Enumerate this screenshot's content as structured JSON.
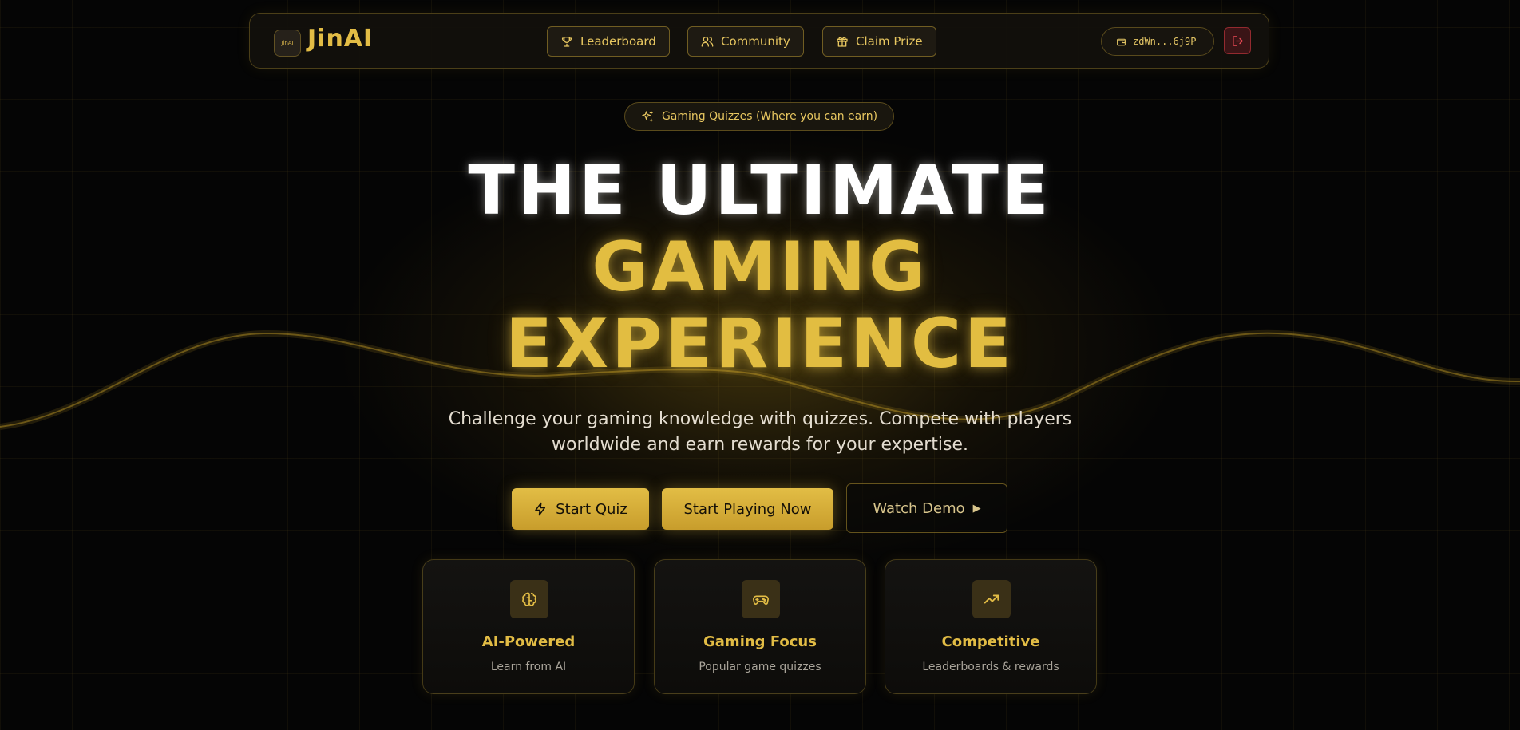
{
  "brand": {
    "logo_mark": "JinAI",
    "name": "JinAI"
  },
  "nav": {
    "items": [
      {
        "label": "Leaderboard",
        "icon": "trophy-icon"
      },
      {
        "label": "Community",
        "icon": "users-icon"
      },
      {
        "label": "Claim Prize",
        "icon": "gift-icon"
      }
    ],
    "wallet_address": "zdWn...6j9P",
    "wallet_icon": "wallet-icon",
    "logout_icon": "logout-icon"
  },
  "badge": {
    "icon": "sparkles-icon",
    "label": "Gaming Quizzes (Where you can earn)"
  },
  "hero": {
    "line1": "THE ULTIMATE",
    "line2": "GAMING",
    "line3": "EXPERIENCE",
    "subtitle": "Challenge your gaming knowledge with quizzes. Compete with players worldwide and earn rewards for your expertise."
  },
  "cta": {
    "start_quiz": "Start Quiz",
    "start_playing": "Start Playing Now",
    "watch_demo": "Watch Demo"
  },
  "features": [
    {
      "icon": "brain-icon",
      "title": "AI-Powered",
      "desc": "Learn from AI"
    },
    {
      "icon": "gamepad-icon",
      "title": "Gaming Focus",
      "desc": "Popular game quizzes"
    },
    {
      "icon": "trending-up-icon",
      "title": "Competitive",
      "desc": "Leaderboards & rewards"
    }
  ],
  "colors": {
    "accent": "#e2bd41",
    "background": "#050505",
    "danger": "#dc3c46"
  }
}
